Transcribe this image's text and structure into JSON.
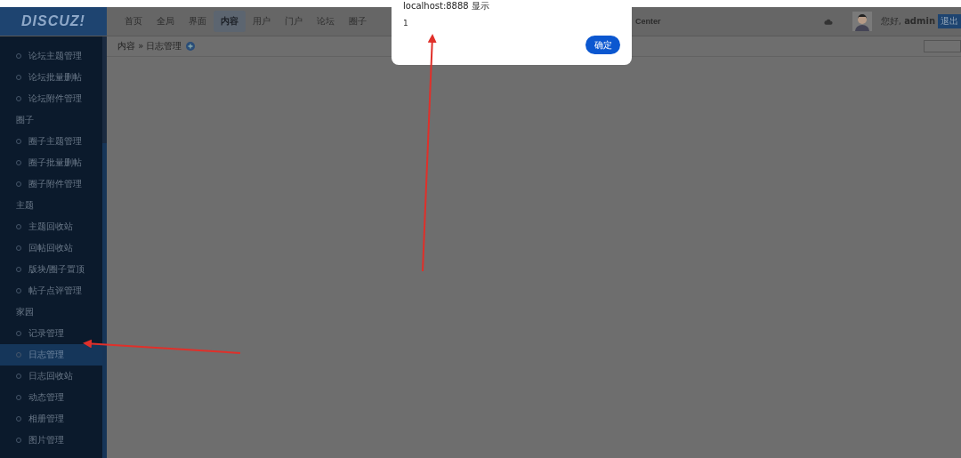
{
  "header": {
    "logo": "DISCUZ!",
    "nav": [
      {
        "label": "首页",
        "selected": false
      },
      {
        "label": "全局",
        "selected": false
      },
      {
        "label": "界面",
        "selected": false
      },
      {
        "label": "内容",
        "selected": true
      },
      {
        "label": "用户",
        "selected": false
      },
      {
        "label": "门户",
        "selected": false
      },
      {
        "label": "论坛",
        "selected": false
      },
      {
        "label": "圈子",
        "selected": false
      }
    ],
    "nav_after_dialog": "Center",
    "greeting": "您好, **admin**",
    "logout": "退出"
  },
  "breadcrumb": "内容 » 日志管理",
  "sidebar": [
    {
      "kind": "item",
      "label": "论坛主题管理",
      "selected": false
    },
    {
      "kind": "item",
      "label": "论坛批量删帖",
      "selected": false
    },
    {
      "kind": "item",
      "label": "论坛附件管理",
      "selected": false
    },
    {
      "kind": "heading",
      "label": "圈子"
    },
    {
      "kind": "item",
      "label": "圈子主题管理",
      "selected": false
    },
    {
      "kind": "item",
      "label": "圈子批量删帖",
      "selected": false
    },
    {
      "kind": "item",
      "label": "圈子附件管理",
      "selected": false
    },
    {
      "kind": "heading",
      "label": "主题"
    },
    {
      "kind": "item",
      "label": "主题回收站",
      "selected": false
    },
    {
      "kind": "item",
      "label": "回帖回收站",
      "selected": false
    },
    {
      "kind": "item",
      "label": "版块/圈子置顶",
      "selected": false
    },
    {
      "kind": "item",
      "label": "帖子点评管理",
      "selected": false
    },
    {
      "kind": "heading",
      "label": "家园"
    },
    {
      "kind": "item",
      "label": "记录管理",
      "selected": false
    },
    {
      "kind": "item",
      "label": "日志管理",
      "selected": true
    },
    {
      "kind": "item",
      "label": "日志回收站",
      "selected": false
    },
    {
      "kind": "item",
      "label": "动态管理",
      "selected": false
    },
    {
      "kind": "item",
      "label": "相册管理",
      "selected": false
    },
    {
      "kind": "item",
      "label": "图片管理",
      "selected": false
    }
  ],
  "dialog": {
    "title": "localhost:8888 显示",
    "message": "1",
    "ok": "确定"
  }
}
